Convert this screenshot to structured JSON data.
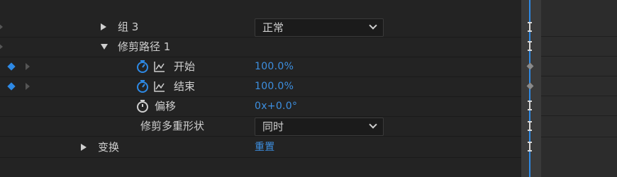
{
  "layers": {
    "group3": {
      "label": "组 3",
      "blend_mode": "正常"
    },
    "trim_paths": {
      "label": "修剪路径 1"
    },
    "start": {
      "label": "开始",
      "value": "100.0%"
    },
    "end": {
      "label": "结束",
      "value": "100.0%"
    },
    "offset": {
      "label": "偏移",
      "value": "0x+0.0°"
    },
    "trim_multiple": {
      "label": "修剪多重形状",
      "option": "同时"
    },
    "transform": {
      "label": "变换",
      "link": "重置"
    }
  },
  "icons": {
    "stopwatch_active": "stopwatch-icon",
    "graph": "graph-icon",
    "keyframe": "keyframe-diamond-icon"
  },
  "colors": {
    "accent": "#2e8ae6",
    "background": "#232323",
    "text": "#cfcfcf"
  }
}
